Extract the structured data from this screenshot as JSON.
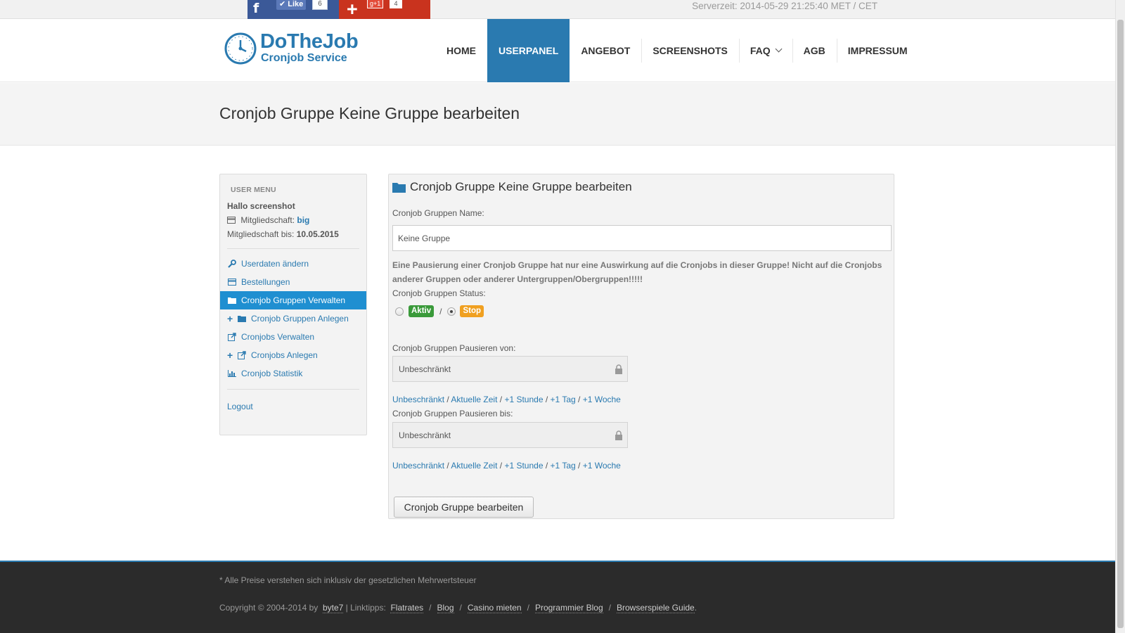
{
  "social": {
    "fb_icon": "f",
    "fb_like": "✔ Like",
    "fb_count": "6",
    "gplus_icon": "+",
    "gplus_badge": "g+1",
    "gplus_count": "4"
  },
  "servertime": "Serverzeit: 2014-05-29 21:25:40 MET / CET",
  "logo": {
    "title": "DoTheJob",
    "subtitle": "Cronjob Service"
  },
  "nav": {
    "items": [
      {
        "label": "HOME"
      },
      {
        "label": "USERPANEL",
        "active": true
      },
      {
        "label": "ANGEBOT"
      },
      {
        "label": "SCREENSHOTS"
      },
      {
        "label": "FAQ"
      },
      {
        "label": "AGB"
      },
      {
        "label": "IMPRESSUM"
      }
    ]
  },
  "page_title": "Cronjob Gruppe Keine Gruppe bearbeiten",
  "sidebar": {
    "heading": "USER MENU",
    "hello": "Hallo screenshot",
    "membership_label": "Mitgliedschaft:",
    "membership_value": "big",
    "membership_until_label": "Mitgliedschaft bis:",
    "membership_until_value": "10.05.2015",
    "items": [
      {
        "label": "Userdaten ändern",
        "icon": "wrench-icon"
      },
      {
        "label": "Bestellungen",
        "icon": "card-icon"
      },
      {
        "label": "Cronjob Gruppen Verwalten",
        "icon": "folder-icon",
        "active": true
      },
      {
        "label": "Cronjob Gruppen Anlegen",
        "icon": "folder-icon",
        "plus": true
      },
      {
        "label": "Cronjobs Verwalten",
        "icon": "external-link-icon"
      },
      {
        "label": "Cronjobs Anlegen",
        "icon": "external-link-icon",
        "plus": true
      },
      {
        "label": "Cronjob Statistik",
        "icon": "bar-chart-icon"
      }
    ],
    "logout": "Logout"
  },
  "form": {
    "title": "Cronjob Gruppe Keine Gruppe bearbeiten",
    "name_label": "Cronjob Gruppen Name:",
    "name_value": "Keine Gruppe",
    "warning": "Eine Pausierung einer Cronjob Gruppe hat nur eine Auswirkung auf die Cronjobs in dieser Gruppe! Nicht auf die Cronjobs anderer Gruppen oder anderer Untergruppen/Obergruppen!!!!!",
    "status_label": "Cronjob Gruppen Status:",
    "status_active": "Aktiv",
    "status_stop": "Stop",
    "status_selected": "Stop",
    "status_sep": "/",
    "pause_from_label": "Cronjob Gruppen Pausieren von:",
    "pause_from_value": "Unbeschränkt",
    "pause_until_label": "Cronjob Gruppen Pausieren bis:",
    "pause_until_value": "Unbeschränkt",
    "quick_links": [
      "Unbeschränkt",
      "Aktuelle Zeit",
      "+1 Stunde",
      "+1 Tag",
      "+1 Woche"
    ],
    "submit": "Cronjob Gruppe bearbeiten"
  },
  "footer": {
    "note": "* Alle Preise verstehen sich inklusiv der gesetzlichen Mehrwertsteuer",
    "copyright": "Copyright © 2004-2014 by",
    "author": "byte7",
    "linktipps": "| Linktipps:",
    "links": [
      "Flatrates",
      "Blog",
      "Casino mieten",
      "Programmier Blog",
      "Browserspiele Guide"
    ],
    "end": "."
  },
  "colors": {
    "accent": "#2a7ab0",
    "active_menu": "#1f8fd1",
    "aktiv": "#3a9a3a",
    "stop": "#f0a020",
    "footer_bg": "#2b2b2b"
  }
}
